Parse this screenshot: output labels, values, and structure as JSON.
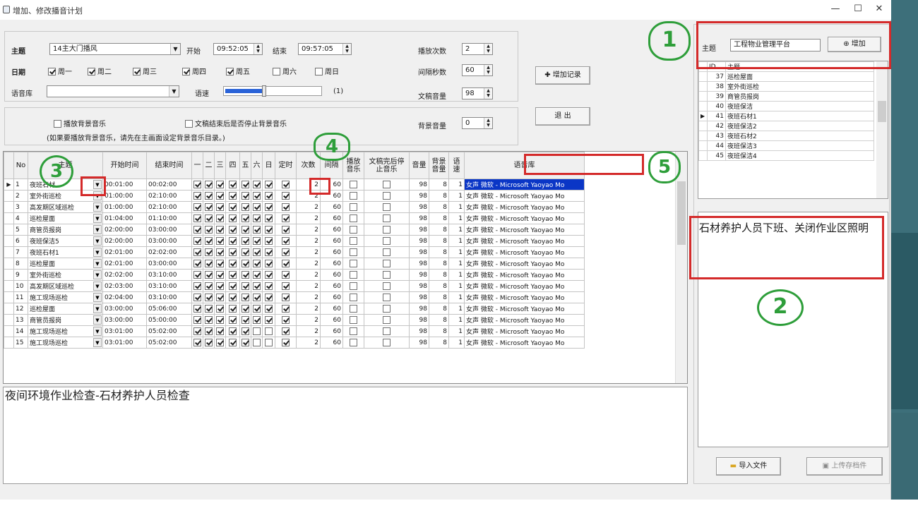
{
  "window": {
    "title": "增加、修改播音计划",
    "minimize": "—",
    "maximize": "☐",
    "close": "✕"
  },
  "form": {
    "theme_label": "主题",
    "theme_value": "14主大门播风",
    "start_label": "开始",
    "start_value": "09:52:05",
    "end_label": "结束",
    "end_value": "09:57:05",
    "play_count_label": "播放次数",
    "play_count_value": "2",
    "date_label": "日期",
    "weekdays": [
      {
        "label": "周一",
        "checked": true
      },
      {
        "label": "周二",
        "checked": true
      },
      {
        "label": "周三",
        "checked": true
      },
      {
        "label": "周四",
        "checked": true
      },
      {
        "label": "周五",
        "checked": true
      },
      {
        "label": "周六",
        "checked": false
      },
      {
        "label": "周日",
        "checked": false
      }
    ],
    "interval_label": "间隔秒数",
    "interval_value": "60",
    "voice_label": "语音库",
    "voice_value": "",
    "speed_label": "语速",
    "speed_level": 0.5,
    "speed_value": "(1)",
    "text_volume_label": "文稿音量",
    "text_volume_value": "98",
    "bg_music_label": "播放背景音乐",
    "bg_music_stop_label": "文稿结束后是否停止背景音乐",
    "bg_volume_label": "背景音量",
    "bg_volume_value": "0",
    "bg_note": "(如果要播放背景音乐，请先在主画面设定背景音乐目录。)",
    "add_record_button": "✚ 增加记录",
    "exit_button": "退 出"
  },
  "grid": {
    "headers": [
      "No",
      "主题",
      "开始时间",
      "结束时间",
      "一",
      "二",
      "三",
      "四",
      "五",
      "六",
      "日",
      "定时",
      "次数",
      "间隔",
      "播放音乐",
      "文稿完后停止音乐",
      "音量",
      "背景音量",
      "语速",
      "语音库"
    ],
    "rows": [
      {
        "no": "1",
        "theme": "夜班石材",
        "start": "00:01:00",
        "end": "00:02:00",
        "days": [
          1,
          1,
          1,
          1,
          1,
          1,
          1
        ],
        "timed": 1,
        "count": "2",
        "interval": "60",
        "music": 0,
        "stop": 0,
        "vol": "98",
        "bgvol": "8",
        "speed": "1",
        "voice": "女声 微软 - Microsoft Yaoyao Mo",
        "selected": true
      },
      {
        "no": "2",
        "theme": "室外街巡检",
        "start": "01:00:00",
        "end": "02:10:00",
        "days": [
          1,
          1,
          1,
          1,
          1,
          1,
          1
        ],
        "timed": 1,
        "count": "2",
        "interval": "60",
        "music": 0,
        "stop": 0,
        "vol": "98",
        "bgvol": "8",
        "speed": "1",
        "voice": "女声 微软 - Microsoft Yaoyao Mo"
      },
      {
        "no": "3",
        "theme": "高发期区域巡检",
        "start": "01:00:00",
        "end": "02:10:00",
        "days": [
          1,
          1,
          1,
          1,
          1,
          1,
          1
        ],
        "timed": 1,
        "count": "2",
        "interval": "60",
        "music": 0,
        "stop": 0,
        "vol": "98",
        "bgvol": "8",
        "speed": "1",
        "voice": "女声 微软 - Microsoft Yaoyao Mo"
      },
      {
        "no": "4",
        "theme": "巡检屋面",
        "start": "01:04:00",
        "end": "01:10:00",
        "days": [
          1,
          1,
          1,
          1,
          1,
          1,
          1
        ],
        "timed": 1,
        "count": "2",
        "interval": "60",
        "music": 0,
        "stop": 0,
        "vol": "98",
        "bgvol": "8",
        "speed": "1",
        "voice": "女声 微软 - Microsoft Yaoyao Mo"
      },
      {
        "no": "5",
        "theme": "商管员报岗",
        "start": "02:00:00",
        "end": "03:00:00",
        "days": [
          1,
          1,
          1,
          1,
          1,
          1,
          1
        ],
        "timed": 1,
        "count": "2",
        "interval": "60",
        "music": 0,
        "stop": 0,
        "vol": "98",
        "bgvol": "8",
        "speed": "1",
        "voice": "女声 微软 - Microsoft Yaoyao Mo"
      },
      {
        "no": "6",
        "theme": "夜班保洁5",
        "start": "02:00:00",
        "end": "03:00:00",
        "days": [
          1,
          1,
          1,
          1,
          1,
          1,
          1
        ],
        "timed": 1,
        "count": "2",
        "interval": "60",
        "music": 0,
        "stop": 0,
        "vol": "98",
        "bgvol": "8",
        "speed": "1",
        "voice": "女声 微软 - Microsoft Yaoyao Mo"
      },
      {
        "no": "7",
        "theme": "夜班石材1",
        "start": "02:01:00",
        "end": "02:02:00",
        "days": [
          1,
          1,
          1,
          1,
          1,
          1,
          1
        ],
        "timed": 1,
        "count": "2",
        "interval": "60",
        "music": 0,
        "stop": 0,
        "vol": "98",
        "bgvol": "8",
        "speed": "1",
        "voice": "女声 微软 - Microsoft Yaoyao Mo"
      },
      {
        "no": "8",
        "theme": "巡检屋面",
        "start": "02:01:00",
        "end": "03:00:00",
        "days": [
          1,
          1,
          1,
          1,
          1,
          1,
          1
        ],
        "timed": 1,
        "count": "2",
        "interval": "60",
        "music": 0,
        "stop": 0,
        "vol": "98",
        "bgvol": "8",
        "speed": "1",
        "voice": "女声 微软 - Microsoft Yaoyao Mo"
      },
      {
        "no": "9",
        "theme": "室外街巡检",
        "start": "02:02:00",
        "end": "03:10:00",
        "days": [
          1,
          1,
          1,
          1,
          1,
          1,
          1
        ],
        "timed": 1,
        "count": "2",
        "interval": "60",
        "music": 0,
        "stop": 0,
        "vol": "98",
        "bgvol": "8",
        "speed": "1",
        "voice": "女声 微软 - Microsoft Yaoyao Mo"
      },
      {
        "no": "10",
        "theme": "高发期区域巡检",
        "start": "02:03:00",
        "end": "03:10:00",
        "days": [
          1,
          1,
          1,
          1,
          1,
          1,
          1
        ],
        "timed": 1,
        "count": "2",
        "interval": "60",
        "music": 0,
        "stop": 0,
        "vol": "98",
        "bgvol": "8",
        "speed": "1",
        "voice": "女声 微软 - Microsoft Yaoyao Mo"
      },
      {
        "no": "11",
        "theme": "施工现场巡检",
        "start": "02:04:00",
        "end": "03:10:00",
        "days": [
          1,
          1,
          1,
          1,
          1,
          1,
          1
        ],
        "timed": 1,
        "count": "2",
        "interval": "60",
        "music": 0,
        "stop": 0,
        "vol": "98",
        "bgvol": "8",
        "speed": "1",
        "voice": "女声 微软 - Microsoft Yaoyao Mo"
      },
      {
        "no": "12",
        "theme": "巡检屋面",
        "start": "03:00:00",
        "end": "05:06:00",
        "days": [
          1,
          1,
          1,
          1,
          1,
          1,
          1
        ],
        "timed": 1,
        "count": "2",
        "interval": "60",
        "music": 0,
        "stop": 0,
        "vol": "98",
        "bgvol": "8",
        "speed": "1",
        "voice": "女声 微软 - Microsoft Yaoyao Mo"
      },
      {
        "no": "13",
        "theme": "商管员报岗",
        "start": "03:00:00",
        "end": "05:00:00",
        "days": [
          1,
          1,
          1,
          1,
          1,
          1,
          1
        ],
        "timed": 1,
        "count": "2",
        "interval": "60",
        "music": 0,
        "stop": 0,
        "vol": "98",
        "bgvol": "8",
        "speed": "1",
        "voice": "女声 微软 - Microsoft Yaoyao Mo"
      },
      {
        "no": "14",
        "theme": "施工现场巡检",
        "start": "03:01:00",
        "end": "05:02:00",
        "days": [
          1,
          1,
          1,
          1,
          1,
          0,
          0
        ],
        "timed": 1,
        "count": "2",
        "interval": "60",
        "music": 0,
        "stop": 0,
        "vol": "98",
        "bgvol": "8",
        "speed": "1",
        "voice": "女声 微软 - Microsoft Yaoyao Mo"
      },
      {
        "no": "15",
        "theme": "施工现场巡检",
        "start": "03:01:00",
        "end": "05:02:00",
        "days": [
          1,
          1,
          1,
          1,
          1,
          0,
          0
        ],
        "timed": 1,
        "count": "2",
        "interval": "60",
        "music": 0,
        "stop": 0,
        "vol": "98",
        "bgvol": "8",
        "speed": "1",
        "voice": "女声 微软 - Microsoft Yaoyao Mo"
      }
    ]
  },
  "bottom_text": "夜间环境作业检查-石材养护人员检查",
  "right": {
    "theme_label": "主题",
    "theme_value": "工程物业管理平台",
    "add_button": "增加",
    "list_header_id": "ID",
    "list_header_theme": "主题",
    "list": [
      {
        "id": "37",
        "name": "巡检屋面",
        "current": false
      },
      {
        "id": "38",
        "name": "室外街巡检",
        "current": false
      },
      {
        "id": "39",
        "name": "商管员报岗",
        "current": false
      },
      {
        "id": "40",
        "name": "夜班保洁",
        "current": false
      },
      {
        "id": "41",
        "name": "夜班石材1",
        "current": true
      },
      {
        "id": "42",
        "name": "夜班保洁2",
        "current": false
      },
      {
        "id": "43",
        "name": "夜班石材2",
        "current": false
      },
      {
        "id": "44",
        "name": "夜班保洁3",
        "current": false
      },
      {
        "id": "45",
        "name": "夜班保洁4",
        "current": false
      }
    ],
    "content_text": "石材养护人员下班、关闭作业区照明",
    "import_button": "导入文件",
    "save_button": "上传存档件"
  },
  "annotations": [
    "1",
    "2",
    "3",
    "4",
    "5"
  ]
}
